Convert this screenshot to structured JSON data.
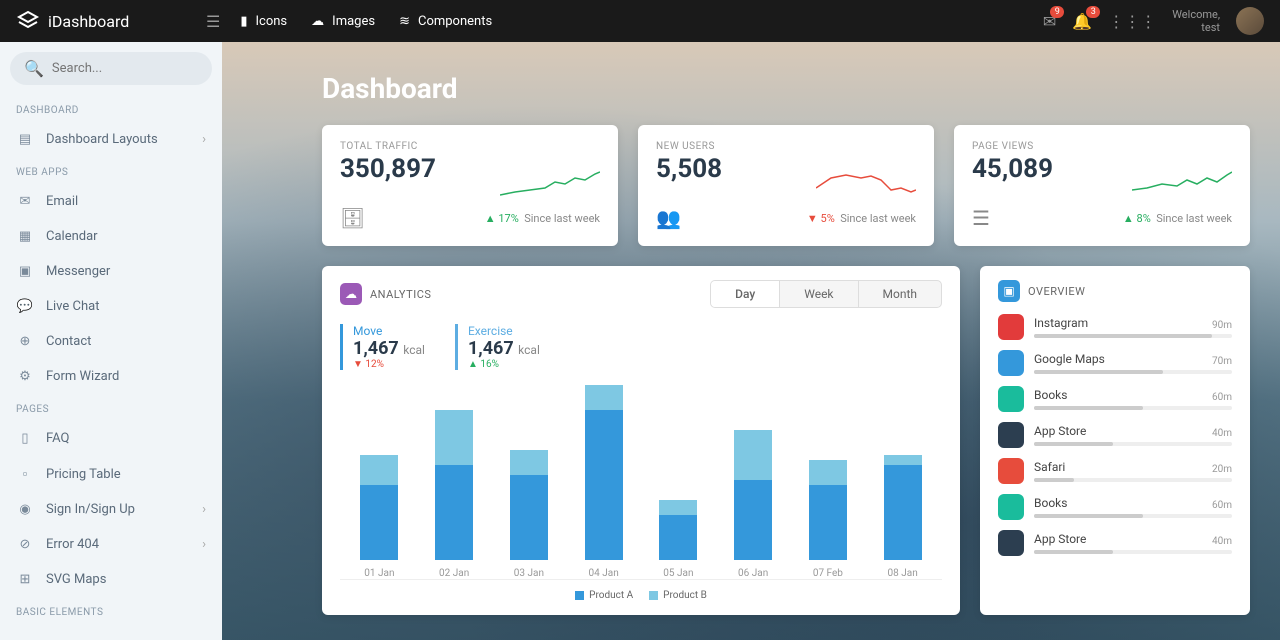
{
  "brand": "iDashboard",
  "topnav": {
    "icons": "Icons",
    "images": "Images",
    "components": "Components"
  },
  "badges": {
    "mail": "9",
    "bell": "3"
  },
  "welcome": {
    "line1": "Welcome,",
    "line2": "test"
  },
  "search": {
    "placeholder": "Search..."
  },
  "sidebar": {
    "sec1": "DASHBOARD",
    "dash_layouts": "Dashboard Layouts",
    "sec2": "WEB APPS",
    "email": "Email",
    "calendar": "Calendar",
    "messenger": "Messenger",
    "livechat": "Live Chat",
    "contact": "Contact",
    "formwizard": "Form Wizard",
    "sec3": "PAGES",
    "faq": "FAQ",
    "pricing": "Pricing Table",
    "signin": "Sign In/Sign Up",
    "error": "Error 404",
    "svgmaps": "SVG Maps",
    "sec4": "BASIC ELEMENTS"
  },
  "page_title": "Dashboard",
  "stats": [
    {
      "label": "TOTAL TRAFFIC",
      "value": "350,897",
      "change": "17%",
      "dir": "up",
      "since": "Since last week"
    },
    {
      "label": "NEW USERS",
      "value": "5,508",
      "change": "5%",
      "dir": "down",
      "since": "Since last week"
    },
    {
      "label": "PAGE VIEWS",
      "value": "45,089",
      "change": "8%",
      "dir": "up",
      "since": "Since last week"
    }
  ],
  "analytics": {
    "title": "ANALYTICS",
    "tabs": {
      "day": "Day",
      "week": "Week",
      "month": "Month"
    },
    "move": {
      "label": "Move",
      "value": "1,467",
      "unit": "kcal",
      "change": "12%"
    },
    "exercise": {
      "label": "Exercise",
      "value": "1,467",
      "unit": "kcal",
      "change": "16%"
    },
    "legend": {
      "a": "Product A",
      "b": "Product B"
    }
  },
  "overview": {
    "title": "OVERVIEW",
    "items": [
      {
        "name": "Instagram",
        "time": "90m",
        "color": "#e23b3b",
        "pct": 90
      },
      {
        "name": "Google Maps",
        "time": "70m",
        "color": "#3498db",
        "pct": 65
      },
      {
        "name": "Books",
        "time": "60m",
        "color": "#1abc9c",
        "pct": 55
      },
      {
        "name": "App Store",
        "time": "40m",
        "color": "#2c3e50",
        "pct": 40
      },
      {
        "name": "Safari",
        "time": "20m",
        "color": "#e74c3c",
        "pct": 20
      },
      {
        "name": "Books",
        "time": "60m",
        "color": "#1abc9c",
        "pct": 55
      },
      {
        "name": "App Store",
        "time": "40m",
        "color": "#2c3e50",
        "pct": 40
      }
    ]
  },
  "chart_data": {
    "type": "bar",
    "categories": [
      "01 Jan",
      "02 Jan",
      "03 Jan",
      "04 Jan",
      "05 Jan",
      "06 Jan",
      "07 Feb",
      "08 Jan"
    ],
    "series": [
      {
        "name": "Product A",
        "values": [
          75,
          95,
          85,
          150,
          45,
          80,
          75,
          95
        ]
      },
      {
        "name": "Product B",
        "values": [
          30,
          55,
          25,
          25,
          15,
          50,
          25,
          10
        ]
      }
    ],
    "ylim": [
      0,
      180
    ],
    "stacked": true
  }
}
